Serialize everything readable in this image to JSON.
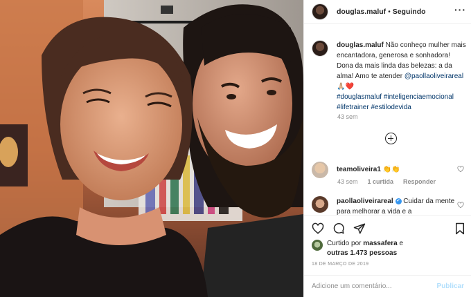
{
  "post": {
    "username": "douglas.maluf",
    "separator": "•",
    "follow_status": "Seguindo",
    "more_icon": "more-horizontal-icon",
    "photo_description_icon": "photo"
  },
  "caption": {
    "username": "douglas.maluf",
    "text": " Não conheço mulher mais encantadora, generosa e sonhadora! Dona da mais linda das belezas: a da alma! Amo te atender ",
    "mention": "@paollaoliveirareal",
    "emoji": "🙏🏼❤️",
    "hashtags": "#douglasmaluf #inteligenciaemocional #lifetrainer #estilodevida",
    "time": "43 sem"
  },
  "load_more_icon": "plus-circle-icon",
  "comments": [
    {
      "username": "teamoliveira1",
      "text": " 👏👏",
      "time": "43 sem",
      "likes": "1 curtida",
      "reply": "Responder"
    },
    {
      "username": "paollaoliveirareal",
      "verified": "✔",
      "text": " Cuidar da mente para melhorar a vida e a"
    }
  ],
  "likes": {
    "prefix": "Curtido por ",
    "user": "massafera",
    "middle": " e",
    "others": "outras 1.473 pessoas"
  },
  "date": "18 DE MARÇO DE 2019",
  "comment_input": {
    "placeholder": "Adicione um comentário...",
    "submit": "Publicar"
  },
  "colors": {
    "link": "#003569",
    "muted": "#8e8e8e",
    "publish_disabled": "#b2dffc",
    "verified": "#3897f0"
  }
}
